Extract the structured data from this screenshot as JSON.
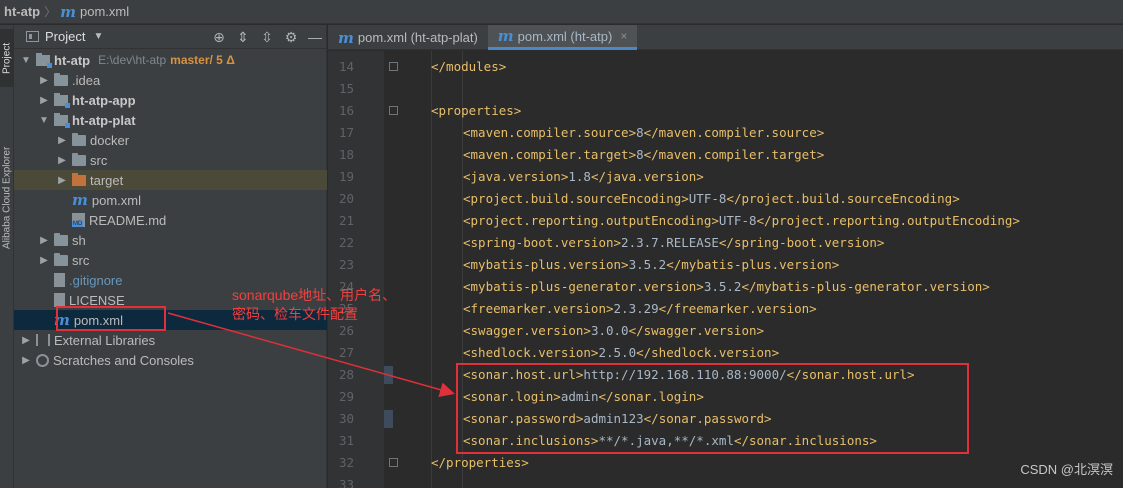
{
  "breadcrumb": {
    "project": "ht-atp",
    "file": "pom.xml"
  },
  "stripe": {
    "project_tab": "Project",
    "alibaba_tab": "Alibaba Cloud Explorer"
  },
  "panel": {
    "title": "Project"
  },
  "tree": {
    "root": {
      "label": "ht-atp",
      "path": "E:\\dev\\ht-atp",
      "branch": "master/ 5 Δ"
    },
    "idea": ".idea",
    "app": "ht-atp-app",
    "plat": "ht-atp-plat",
    "docker": "docker",
    "src_plat": "src",
    "target": "target",
    "pom_plat": "pom.xml",
    "readme": "README.md",
    "sh": "sh",
    "src": "src",
    "gitignore": ".gitignore",
    "license": "LICENSE",
    "pom": "pom.xml",
    "external": "External Libraries",
    "scratches": "Scratches and Consoles"
  },
  "tabs": [
    {
      "label": "pom.xml (ht-atp-plat)"
    },
    {
      "label": "pom.xml (ht-atp)",
      "close": "×"
    }
  ],
  "editor": {
    "lines": [
      {
        "num": "14",
        "tag_open": "</modules>",
        "text": "",
        "tag_close": ""
      },
      {
        "num": "15",
        "tag_open": "",
        "text": "",
        "tag_close": ""
      },
      {
        "num": "16",
        "tag_open": "<properties>",
        "text": "",
        "tag_close": ""
      },
      {
        "num": "17",
        "tag_open": "<maven.compiler.source>",
        "text": "8",
        "tag_close": "</maven.compiler.source>"
      },
      {
        "num": "18",
        "tag_open": "<maven.compiler.target>",
        "text": "8",
        "tag_close": "</maven.compiler.target>"
      },
      {
        "num": "19",
        "tag_open": "<java.version>",
        "text": "1.8",
        "tag_close": "</java.version>"
      },
      {
        "num": "20",
        "tag_open": "<project.build.sourceEncoding>",
        "text": "UTF-8",
        "tag_close": "</project.build.sourceEncoding>"
      },
      {
        "num": "21",
        "tag_open": "<project.reporting.outputEncoding>",
        "text": "UTF-8",
        "tag_close": "</project.reporting.outputEncoding>"
      },
      {
        "num": "22",
        "tag_open": "<spring-boot.version>",
        "text": "2.3.7.RELEASE",
        "tag_close": "</spring-boot.version>"
      },
      {
        "num": "23",
        "tag_open": "<mybatis-plus.version>",
        "text": "3.5.2",
        "tag_close": "</mybatis-plus.version>"
      },
      {
        "num": "24",
        "tag_open": "<mybatis-plus-generator.version>",
        "text": "3.5.2",
        "tag_close": "</mybatis-plus-generator.version>"
      },
      {
        "num": "25",
        "tag_open": "<freemarker.version>",
        "text": "2.3.29",
        "tag_close": "</freemarker.version>"
      },
      {
        "num": "26",
        "tag_open": "<swagger.version>",
        "text": "3.0.0",
        "tag_close": "</swagger.version>"
      },
      {
        "num": "27",
        "tag_open": "<shedlock.version>",
        "text": "2.5.0",
        "tag_close": "</shedlock.version>"
      },
      {
        "num": "28",
        "tag_open": "<sonar.host.url>",
        "text": "http://192.168.110.88:9000/",
        "tag_close": "</sonar.host.url>"
      },
      {
        "num": "29",
        "tag_open": "<sonar.login>",
        "text": "admin",
        "tag_close": "</sonar.login>"
      },
      {
        "num": "30",
        "tag_open": "<sonar.password>",
        "text": "admin123",
        "tag_close": "</sonar.password>"
      },
      {
        "num": "31",
        "tag_open": "<sonar.inclusions>",
        "text": "**/*.java,**/*.xml",
        "tag_close": "</sonar.inclusions>"
      },
      {
        "num": "32",
        "tag_open": "</properties>",
        "text": "",
        "tag_close": ""
      },
      {
        "num": "33",
        "tag_open": "",
        "text": "",
        "tag_close": ""
      }
    ]
  },
  "annotation": {
    "line1": "sonarqube地址、用户名、",
    "line2": "密码、检车文件配置"
  },
  "watermark": "CSDN @北溟溟",
  "colors": {
    "annotation_red": "#e0303a",
    "tag_yellow": "#e8bf6a",
    "selection_blue": "#0d293e"
  }
}
